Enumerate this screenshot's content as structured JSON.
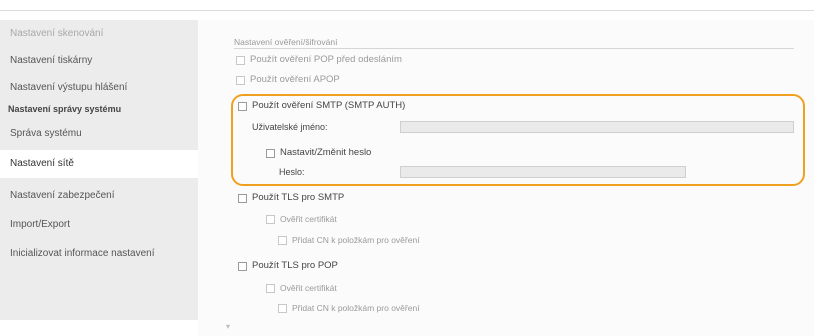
{
  "sidebar": {
    "items": [
      {
        "label": "Nastavení skenování",
        "state": "dim"
      },
      {
        "label": "Nastavení tiskárny",
        "state": "normal"
      },
      {
        "label": "Nastavení výstupu hlášení",
        "state": "normal"
      },
      {
        "label": "Nastavení správy systému",
        "state": "section"
      },
      {
        "label": "Správa systému",
        "state": "normal"
      },
      {
        "label": "Nastavení sítě",
        "state": "active"
      },
      {
        "label": "Nastavení zabezpečení",
        "state": "normal"
      },
      {
        "label": "Import/Export",
        "state": "normal"
      },
      {
        "label": "Inicializovat informace nastavení",
        "state": "normal"
      }
    ]
  },
  "auth": {
    "section_title": "Nastavení ověření/šifrování",
    "pop_before_send": "Použít ověření POP před odesláním",
    "apop": "Použít ověření APOP",
    "smtp_auth": "Použít ověření SMTP (SMTP AUTH)",
    "username_label": "Uživatelské jméno:",
    "username_value": "",
    "set_change_password": "Nastavit/Změnit heslo",
    "password_label": "Heslo:",
    "password_value": "",
    "tls_smtp": "Použít TLS pro SMTP",
    "tls_smtp_verify": "Ověřit certifikát",
    "tls_smtp_cn": "Přidat CN k položkám pro ověření",
    "tls_pop": "Použít TLS pro POP",
    "tls_pop_verify": "Ověřit certifikát",
    "tls_pop_cn": "Přidat CN k položkám pro ověření"
  },
  "colors": {
    "highlight": "#f0a020",
    "sidebar_bg": "#ececec"
  }
}
